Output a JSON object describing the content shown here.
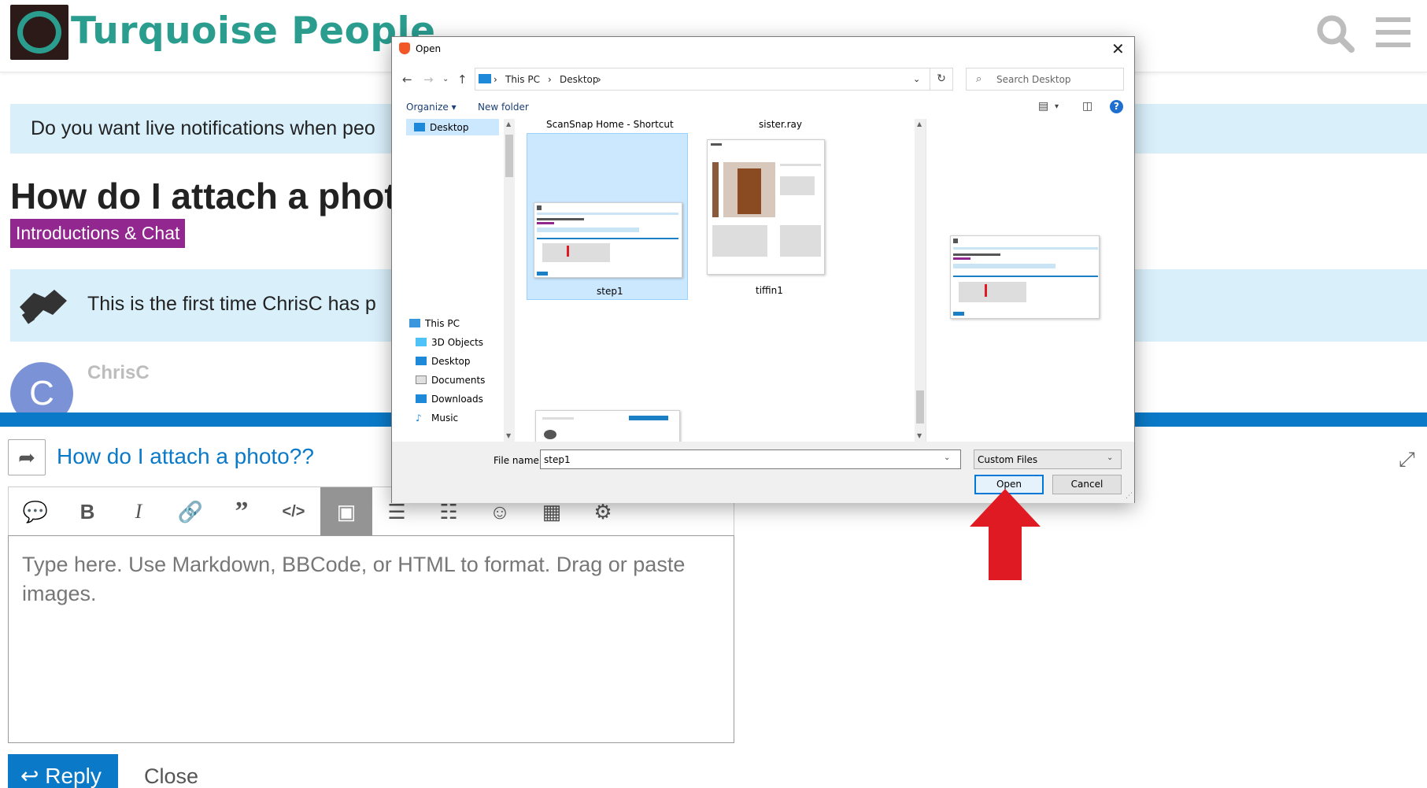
{
  "site": {
    "title": "Turquoise People",
    "brand_color": "#2a9d8f",
    "icons": [
      "search-icon",
      "hamburger-menu-icon"
    ]
  },
  "page": {
    "notification_text": "Do you want live notifications when peo",
    "topic_title": "How do I attach a phot",
    "category": "Introductions & Chat",
    "category_color": "#92278f",
    "first_post_text": "This is the first time ChrisC has p",
    "avatar_letter": "C",
    "username": "ChrisC"
  },
  "composer": {
    "reply_title": "How do I attach a photo??",
    "placeholder": "Type here. Use Markdown, BBCode, or HTML to format. Drag or paste images.",
    "reply_label": "Reply",
    "close_label": "Close",
    "toolbar": [
      "quote-icon",
      "bold-icon",
      "italic-icon",
      "link-icon",
      "blockquote-icon",
      "code-icon",
      "image-icon",
      "bullet-list-icon",
      "numbered-list-icon",
      "emoji-icon",
      "calendar-icon",
      "settings-icon"
    ],
    "accent_color": "#0a7ac8"
  },
  "dialog": {
    "title": "Open",
    "breadcrumb": [
      "This PC",
      "Desktop"
    ],
    "search_placeholder": "Search Desktop",
    "organize_label": "Organize",
    "new_folder_label": "New folder",
    "nav_quick": "Desktop",
    "nav_items": [
      "This PC",
      "3D Objects",
      "Desktop",
      "Documents",
      "Downloads",
      "Music"
    ],
    "files_top_labels": [
      "ScanSnap Home - Shortcut",
      "sister.ray"
    ],
    "files": [
      {
        "name": "step1",
        "selected": true
      },
      {
        "name": "tiffin1",
        "selected": false
      }
    ],
    "file_name_label": "File name:",
    "file_name_value": "step1",
    "file_type": "Custom Files",
    "open_label": "Open",
    "cancel_label": "Cancel"
  }
}
